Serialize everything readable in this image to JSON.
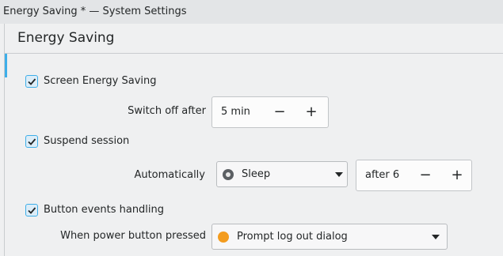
{
  "window": {
    "title": "Energy Saving * — System Settings"
  },
  "header": {
    "title": "Energy Saving"
  },
  "screen_energy_saving": {
    "label": "Screen Energy Saving",
    "checked": true,
    "switch_off_label": "Switch off after",
    "switch_off_value": "5 min"
  },
  "suspend_session": {
    "label": "Suspend session",
    "checked": true,
    "automatically_label": "Automatically",
    "action_value": "Sleep",
    "after_value": "after 6"
  },
  "button_events": {
    "label": "Button events handling",
    "checked": true,
    "power_button_label": "When power button pressed",
    "power_button_value": "Prompt log out dialog"
  },
  "icons": {
    "checkbox": "checkmark-icon",
    "minus": "minus-icon",
    "plus": "plus-icon",
    "dropdown": "chevron-down-icon",
    "sleep": "sleep-icon",
    "logout": "logout-icon"
  },
  "colors": {
    "accent": "#3daee9",
    "logout_icon": "#f39c1f"
  }
}
